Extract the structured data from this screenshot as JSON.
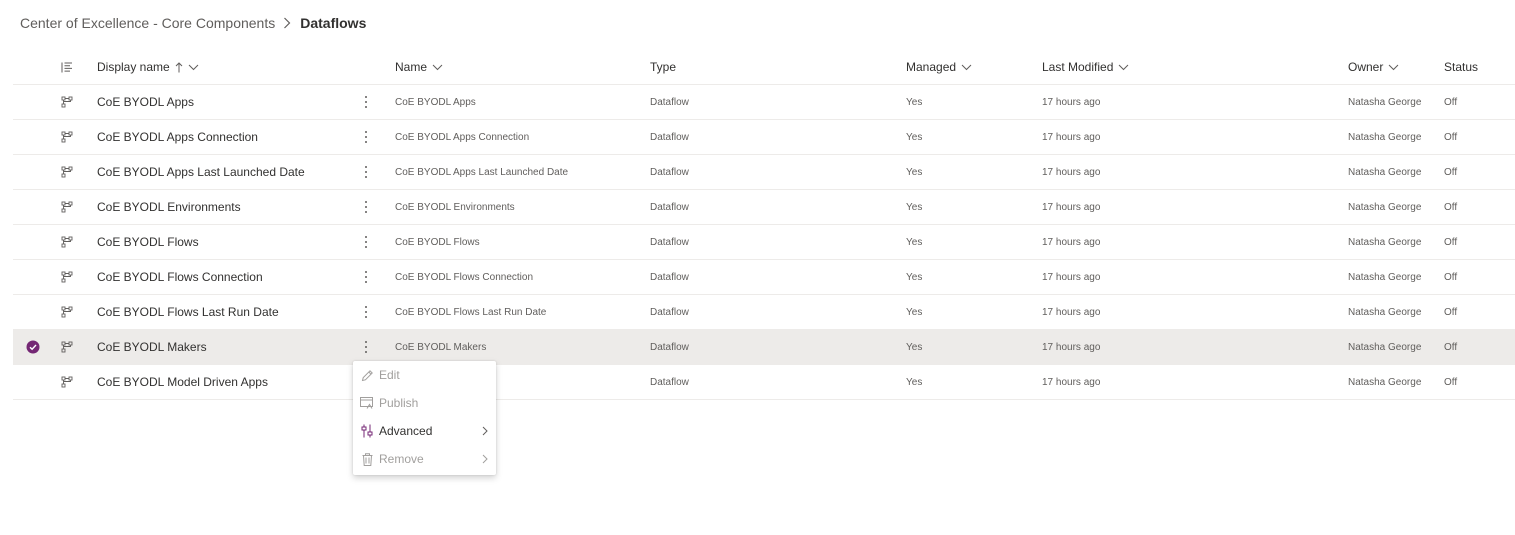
{
  "breadcrumb": {
    "parent": "Center of Excellence - Core Components",
    "current": "Dataflows"
  },
  "columns": {
    "display_name": "Display name",
    "name": "Name",
    "type": "Type",
    "managed": "Managed",
    "last_modified": "Last Modified",
    "owner": "Owner",
    "status": "Status"
  },
  "rows": [
    {
      "display_name": "CoE BYODL Apps",
      "name": "CoE BYODL Apps",
      "type": "Dataflow",
      "managed": "Yes",
      "last_modified": "17 hours ago",
      "owner": "Natasha George",
      "status": "Off"
    },
    {
      "display_name": "CoE BYODL Apps Connection",
      "name": "CoE BYODL Apps Connection",
      "type": "Dataflow",
      "managed": "Yes",
      "last_modified": "17 hours ago",
      "owner": "Natasha George",
      "status": "Off"
    },
    {
      "display_name": "CoE BYODL Apps Last Launched Date",
      "name": "CoE BYODL Apps Last Launched Date",
      "type": "Dataflow",
      "managed": "Yes",
      "last_modified": "17 hours ago",
      "owner": "Natasha George",
      "status": "Off"
    },
    {
      "display_name": "CoE BYODL Environments",
      "name": "CoE BYODL Environments",
      "type": "Dataflow",
      "managed": "Yes",
      "last_modified": "17 hours ago",
      "owner": "Natasha George",
      "status": "Off"
    },
    {
      "display_name": "CoE BYODL Flows",
      "name": "CoE BYODL Flows",
      "type": "Dataflow",
      "managed": "Yes",
      "last_modified": "17 hours ago",
      "owner": "Natasha George",
      "status": "Off"
    },
    {
      "display_name": "CoE BYODL Flows Connection",
      "name": "CoE BYODL Flows Connection",
      "type": "Dataflow",
      "managed": "Yes",
      "last_modified": "17 hours ago",
      "owner": "Natasha George",
      "status": "Off"
    },
    {
      "display_name": "CoE BYODL Flows Last Run Date",
      "name": "CoE BYODL Flows Last Run Date",
      "type": "Dataflow",
      "managed": "Yes",
      "last_modified": "17 hours ago",
      "owner": "Natasha George",
      "status": "Off"
    },
    {
      "display_name": "CoE BYODL Makers",
      "name": "CoE BYODL Makers",
      "type": "Dataflow",
      "managed": "Yes",
      "last_modified": "17 hours ago",
      "owner": "Natasha George",
      "status": "Off",
      "selected": true
    },
    {
      "display_name": "CoE BYODL Model Driven Apps",
      "name": "n Apps",
      "type": "Dataflow",
      "managed": "Yes",
      "last_modified": "17 hours ago",
      "owner": "Natasha George",
      "status": "Off"
    }
  ],
  "context_menu": {
    "items": [
      {
        "label": "Edit",
        "icon": "pencil-icon",
        "disabled": true
      },
      {
        "label": "Publish",
        "icon": "publish-icon",
        "disabled": true
      },
      {
        "label": "Advanced",
        "icon": "advanced-icon",
        "disabled": false,
        "submenu": true
      },
      {
        "label": "Remove",
        "icon": "trash-icon",
        "disabled": true,
        "submenu": true
      }
    ]
  },
  "colors": {
    "accent": "#742774",
    "selected_row": "#edebe9",
    "divider": "#edebe9"
  }
}
